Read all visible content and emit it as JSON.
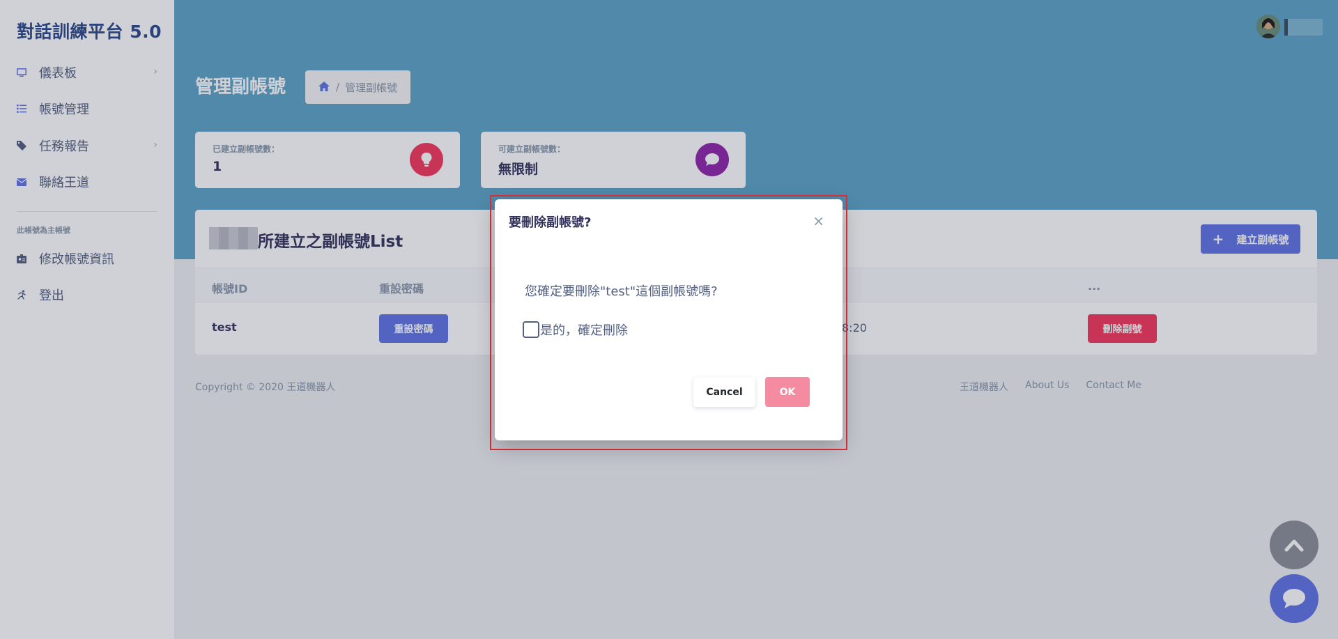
{
  "brand": "對話訓練平台 5.0",
  "sidebar": {
    "items": [
      {
        "label": "儀表板",
        "icon": "monitor-icon",
        "chevron": "›"
      },
      {
        "label": "帳號管理",
        "icon": "list-icon"
      },
      {
        "label": "任務報告",
        "icon": "tag-icon",
        "chevron": "›"
      },
      {
        "label": "聯絡王道",
        "icon": "envelope-icon"
      }
    ],
    "heading": "此帳號為主帳號",
    "sub_items": [
      {
        "label": "修改帳號資訊",
        "icon": "id-card-icon"
      },
      {
        "label": "登出",
        "icon": "running-icon"
      }
    ]
  },
  "header": {
    "page_title": "管理副帳號",
    "breadcrumb_current": "管理副帳號",
    "breadcrumb_sep": "/"
  },
  "stats": [
    {
      "label": "已建立副帳號數：",
      "value": "1",
      "icon": "lightbulb-icon",
      "color": "#f5365c"
    },
    {
      "label": "可建立副帳號數：",
      "value": "無限制",
      "icon": "chat-bubble-icon",
      "color": "#8e24aa"
    }
  ],
  "list": {
    "title": "所建立之副帳號List",
    "add_button": "建立副帳號",
    "add_button_icon": "+",
    "columns": [
      "帳號ID",
      "重設密碼",
      "..."
    ],
    "rows": [
      {
        "id": "test",
        "reset_button": "重設密碼",
        "time_partial": "8:20",
        "delete_button": "刪除副號"
      }
    ]
  },
  "footer": {
    "copyright": "Copyright © 2020 王道機器人",
    "links": [
      "王道機器人",
      "About Us",
      "Contact Me"
    ]
  },
  "modal": {
    "title": "要刪除副帳號?",
    "close": "×",
    "message": "您確定要刪除\"test\"這個副帳號嗎?",
    "checkbox_label": "是的，確定刪除",
    "checked": false,
    "cancel": "Cancel",
    "ok": "OK"
  },
  "colors": {
    "header": "#5ba3c6",
    "primary": "#5e72e4",
    "danger": "#f5365c",
    "ok_disabled": "#f58ba0",
    "highlight": "#e02f3a"
  }
}
